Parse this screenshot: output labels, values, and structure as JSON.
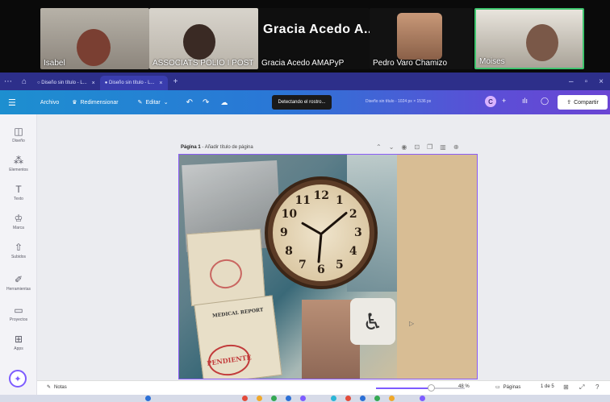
{
  "call": {
    "participants": [
      {
        "name": "Isabel"
      },
      {
        "name": "ASSOCIATS POLIO I POST"
      },
      {
        "name": "Gracia Acedo AMAPyP",
        "display": "Gracia Acedo A..."
      },
      {
        "name": "Pedro Varo Chamizo"
      },
      {
        "name": "Moises"
      }
    ]
  },
  "browser": {
    "tabs": [
      {
        "label": "Diseño sin título - L..."
      },
      {
        "label": "Diseño sin título - L..."
      }
    ]
  },
  "toolbar": {
    "file_label": "Archivo",
    "resize_label": "Redimensionar",
    "edit_label": "Editar",
    "toast": "Detectando el rostro...",
    "doc_title": "Diseño sin título - 1024 px × 1536 px",
    "avatar_initial": "C",
    "share_label": "Compartir"
  },
  "sidebar": {
    "items": [
      {
        "label": "Diseño",
        "icon": "layout-icon"
      },
      {
        "label": "Elementos",
        "icon": "elements-icon"
      },
      {
        "label": "Texto",
        "icon": "text-icon"
      },
      {
        "label": "Marca",
        "icon": "brand-icon"
      },
      {
        "label": "Subidos",
        "icon": "upload-icon"
      },
      {
        "label": "Herramientas",
        "icon": "draw-icon"
      },
      {
        "label": "Proyectos",
        "icon": "folder-icon"
      },
      {
        "label": "Apps",
        "icon": "apps-icon"
      }
    ]
  },
  "page": {
    "title_prefix": "Página 1",
    "title_placeholder": " - Añadir título de página"
  },
  "design": {
    "report_text": "MEDICAL REPORT",
    "stamp_text": "PENDIENTE",
    "clock_numbers": [
      "12",
      "1",
      "2",
      "3",
      "4",
      "5",
      "6",
      "7",
      "8",
      "9",
      "10",
      "11"
    ]
  },
  "bottombar": {
    "notes_label": "Notas",
    "zoom": "48 %",
    "zoom_value": 48,
    "pages_label": "Páginas",
    "page_count": "1 de 5"
  },
  "colors": {
    "toolbar_start": "#1d8fd0",
    "toolbar_end": "#6a45d4",
    "accent": "#8b5cf6",
    "speaker_border": "#3ec46d"
  }
}
